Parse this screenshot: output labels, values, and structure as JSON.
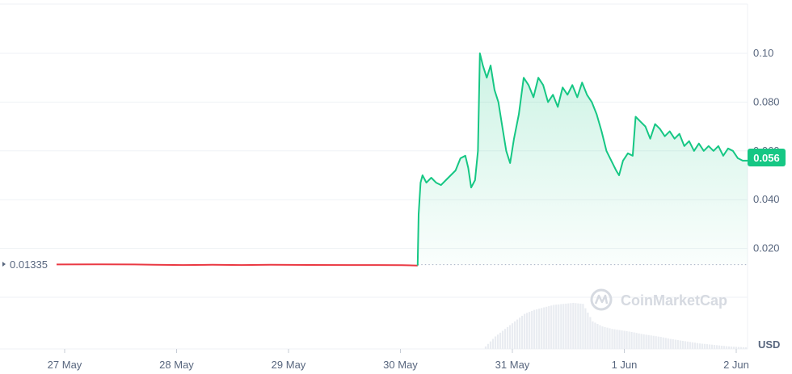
{
  "chart_data": {
    "type": "line",
    "currency_label": "USD",
    "reference_label": "0.01335",
    "reference_value": 0.01335,
    "current_label": "0.056",
    "current_value": 0.056,
    "watermark": "CoinMarketCap",
    "colors": {
      "up": "#16c784",
      "down": "#ea3943",
      "fill_top": "#c9f1e0",
      "volume": "#e9ecf1",
      "grid": "#eff2f5",
      "text": "#58667e"
    },
    "y_ticks": [
      {
        "value": 0.02,
        "label": "0.020"
      },
      {
        "value": 0.04,
        "label": "0.040"
      },
      {
        "value": 0.06,
        "label": "0.060"
      },
      {
        "value": 0.08,
        "label": "0.080"
      },
      {
        "value": 0.1,
        "label": "0.10"
      }
    ],
    "ylim": [
      0,
      0.1
    ],
    "x_ticks": [
      {
        "x": 0.5,
        "label": "27 May"
      },
      {
        "x": 1.5,
        "label": "28 May"
      },
      {
        "x": 2.5,
        "label": "29 May"
      },
      {
        "x": 3.5,
        "label": "30 May"
      },
      {
        "x": 4.5,
        "label": "31 May"
      },
      {
        "x": 5.5,
        "label": "1 Jun"
      },
      {
        "x": 6.5,
        "label": "2 Jun"
      }
    ],
    "xlim": [
      0,
      7.1
    ],
    "series": [
      {
        "points": [
          [
            0,
            0.01345
          ],
          [
            0.4,
            0.0135
          ],
          [
            0.8,
            0.01345
          ],
          [
            1.0,
            0.0133
          ],
          [
            1.3,
            0.0132
          ],
          [
            1.6,
            0.0133
          ],
          [
            1.9,
            0.0132
          ],
          [
            2.2,
            0.0133
          ],
          [
            2.6,
            0.01325
          ],
          [
            3.0,
            0.0132
          ],
          [
            3.3,
            0.0132
          ],
          [
            3.55,
            0.01315
          ],
          [
            3.71,
            0.013
          ],
          [
            3.72,
            0.034
          ],
          [
            3.74,
            0.047
          ],
          [
            3.76,
            0.05
          ],
          [
            3.8,
            0.047
          ],
          [
            3.85,
            0.049
          ],
          [
            3.9,
            0.047
          ],
          [
            3.95,
            0.046
          ],
          [
            4.0,
            0.048
          ],
          [
            4.05,
            0.05
          ],
          [
            4.1,
            0.052
          ],
          [
            4.15,
            0.057
          ],
          [
            4.2,
            0.058
          ],
          [
            4.23,
            0.053
          ],
          [
            4.26,
            0.045
          ],
          [
            4.3,
            0.048
          ],
          [
            4.33,
            0.06
          ],
          [
            4.35,
            0.1
          ],
          [
            4.38,
            0.095
          ],
          [
            4.42,
            0.09
          ],
          [
            4.46,
            0.095
          ],
          [
            4.5,
            0.085
          ],
          [
            4.54,
            0.08
          ],
          [
            4.58,
            0.07
          ],
          [
            4.62,
            0.06
          ],
          [
            4.66,
            0.055
          ],
          [
            4.7,
            0.065
          ],
          [
            4.75,
            0.075
          ],
          [
            4.8,
            0.09
          ],
          [
            4.85,
            0.087
          ],
          [
            4.9,
            0.082
          ],
          [
            4.95,
            0.09
          ],
          [
            5.0,
            0.087
          ],
          [
            5.05,
            0.08
          ],
          [
            5.1,
            0.083
          ],
          [
            5.15,
            0.078
          ],
          [
            5.2,
            0.086
          ],
          [
            5.25,
            0.083
          ],
          [
            5.3,
            0.087
          ],
          [
            5.35,
            0.082
          ],
          [
            5.4,
            0.088
          ],
          [
            5.45,
            0.083
          ],
          [
            5.5,
            0.08
          ],
          [
            5.55,
            0.075
          ],
          [
            5.6,
            0.068
          ],
          [
            5.65,
            0.06
          ],
          [
            5.7,
            0.056
          ],
          [
            5.75,
            0.052
          ],
          [
            5.78,
            0.05
          ],
          [
            5.82,
            0.056
          ],
          [
            5.87,
            0.059
          ],
          [
            5.92,
            0.058
          ],
          [
            5.95,
            0.074
          ],
          [
            6.0,
            0.072
          ],
          [
            6.05,
            0.07
          ],
          [
            6.1,
            0.065
          ],
          [
            6.15,
            0.071
          ],
          [
            6.2,
            0.069
          ],
          [
            6.25,
            0.066
          ],
          [
            6.3,
            0.068
          ],
          [
            6.35,
            0.065
          ],
          [
            6.4,
            0.067
          ],
          [
            6.45,
            0.062
          ],
          [
            6.5,
            0.064
          ],
          [
            6.55,
            0.06
          ],
          [
            6.6,
            0.063
          ],
          [
            6.65,
            0.06
          ],
          [
            6.7,
            0.062
          ],
          [
            6.75,
            0.06
          ],
          [
            6.8,
            0.062
          ],
          [
            6.85,
            0.058
          ],
          [
            6.9,
            0.061
          ],
          [
            6.95,
            0.06
          ],
          [
            7.0,
            0.057
          ],
          [
            7.05,
            0.056
          ],
          [
            7.1,
            0.056
          ]
        ]
      }
    ],
    "volume": [
      [
        4.4,
        0.05
      ],
      [
        4.5,
        0.25
      ],
      [
        4.6,
        0.4
      ],
      [
        4.7,
        0.55
      ],
      [
        4.8,
        0.7
      ],
      [
        4.9,
        0.78
      ],
      [
        5.0,
        0.83
      ],
      [
        5.1,
        0.88
      ],
      [
        5.2,
        0.9
      ],
      [
        5.3,
        0.92
      ],
      [
        5.4,
        0.9
      ],
      [
        5.5,
        0.55
      ],
      [
        5.6,
        0.45
      ],
      [
        5.7,
        0.4
      ],
      [
        5.8,
        0.37
      ],
      [
        5.9,
        0.34
      ],
      [
        6.0,
        0.3
      ],
      [
        6.1,
        0.27
      ],
      [
        6.2,
        0.24
      ],
      [
        6.3,
        0.2
      ],
      [
        6.4,
        0.17
      ],
      [
        6.5,
        0.14
      ],
      [
        6.6,
        0.11
      ],
      [
        6.7,
        0.09
      ],
      [
        6.8,
        0.07
      ],
      [
        6.9,
        0.05
      ],
      [
        7.0,
        0.04
      ],
      [
        7.1,
        0.03
      ]
    ]
  }
}
